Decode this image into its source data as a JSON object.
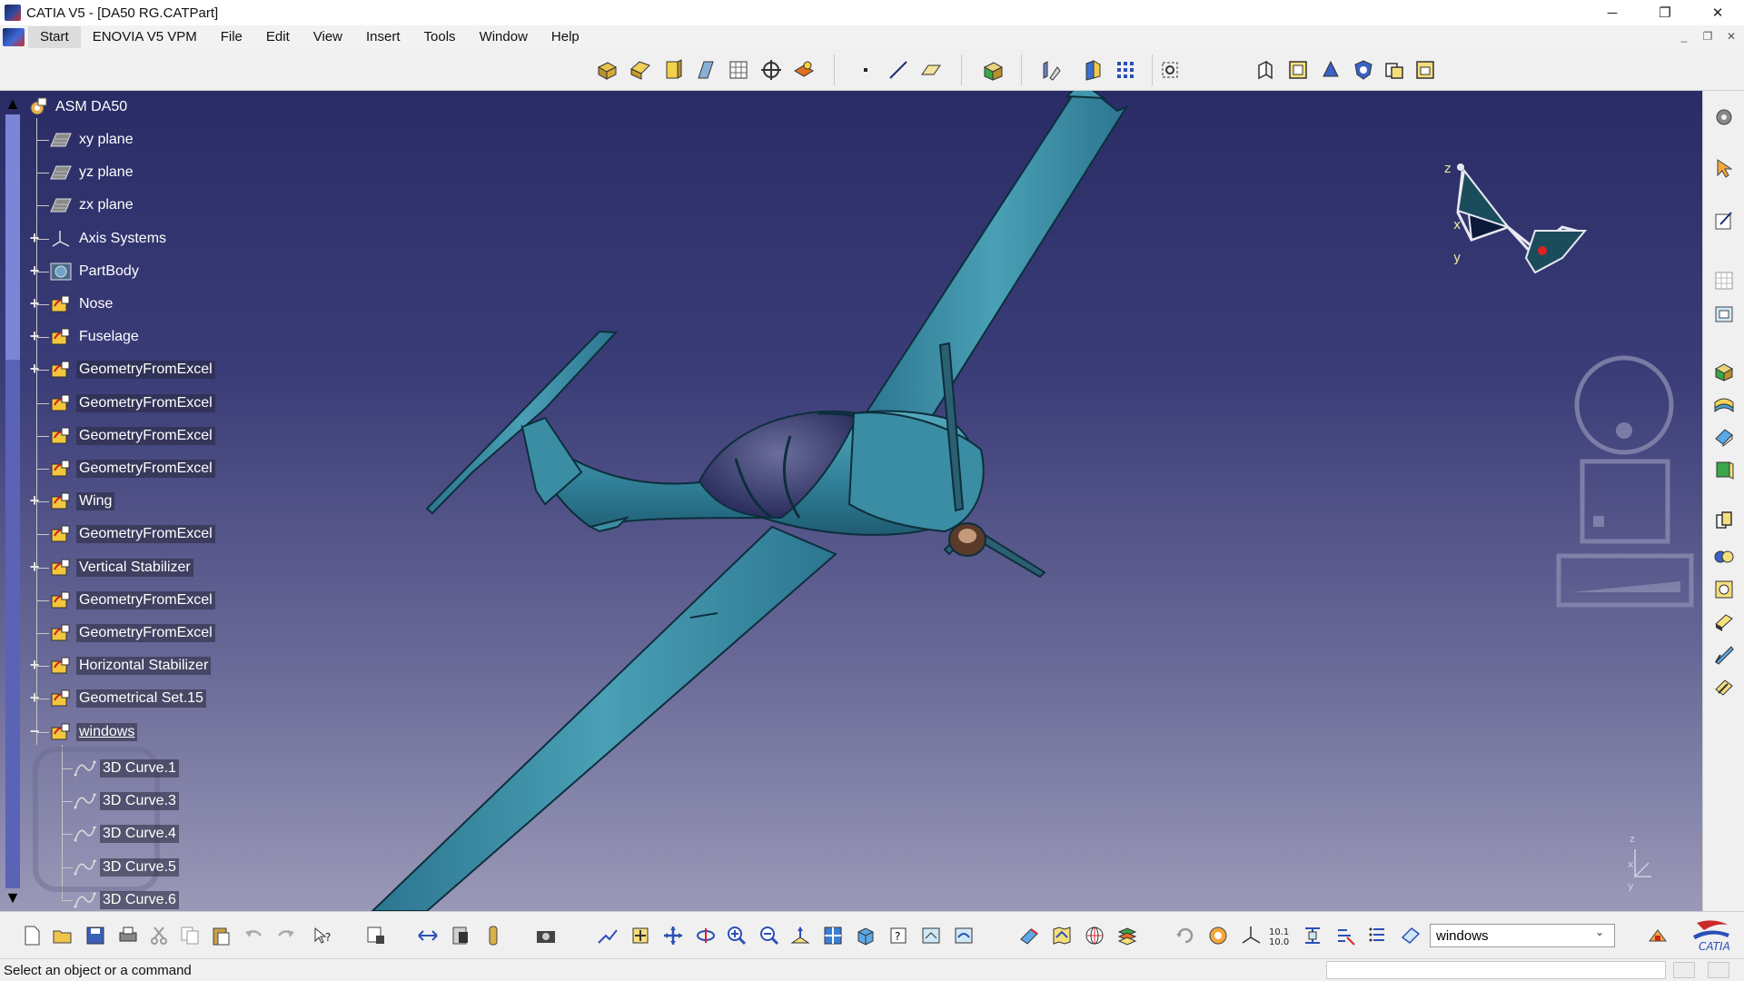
{
  "window": {
    "title": "CATIA V5 - [DA50 RG.CATPart]",
    "minimize": "─",
    "restore": "❐",
    "close": "✕"
  },
  "menu": {
    "items": [
      "Start",
      "ENOVIA V5 VPM",
      "File",
      "Edit",
      "View",
      "Insert",
      "Tools",
      "Window",
      "Help"
    ],
    "mdi_minimize": "_",
    "mdi_restore": "❐",
    "mdi_close": "✕"
  },
  "tree": {
    "root": "ASM DA50",
    "items": [
      {
        "label": "xy plane",
        "icon": "plane-icon",
        "expander": ""
      },
      {
        "label": "yz plane",
        "icon": "plane-icon",
        "expander": ""
      },
      {
        "label": "zx plane",
        "icon": "plane-icon",
        "expander": ""
      },
      {
        "label": "Axis Systems",
        "icon": "axis-system-icon",
        "expander": "+"
      },
      {
        "label": "PartBody",
        "icon": "partbody-icon",
        "expander": "+"
      },
      {
        "label": "Nose",
        "icon": "geometrical-set-icon",
        "expander": "+"
      },
      {
        "label": "Fuselage",
        "icon": "geometrical-set-icon",
        "expander": "+"
      },
      {
        "label": "GeometryFromExcel",
        "icon": "geometrical-set-icon",
        "expander": "+"
      },
      {
        "label": "GeometryFromExcel",
        "icon": "geometrical-set-icon",
        "expander": ""
      },
      {
        "label": "GeometryFromExcel",
        "icon": "geometrical-set-icon",
        "expander": ""
      },
      {
        "label": "GeometryFromExcel",
        "icon": "geometrical-set-icon",
        "expander": ""
      },
      {
        "label": "Wing",
        "icon": "geometrical-set-icon",
        "expander": "+"
      },
      {
        "label": "GeometryFromExcel",
        "icon": "geometrical-set-icon",
        "expander": ""
      },
      {
        "label": "Vertical Stabilizer",
        "icon": "geometrical-set-icon",
        "expander": "+"
      },
      {
        "label": "GeometryFromExcel",
        "icon": "geometrical-set-icon",
        "expander": ""
      },
      {
        "label": "GeometryFromExcel",
        "icon": "geometrical-set-icon",
        "expander": ""
      },
      {
        "label": "Horizontal Stabilizer",
        "icon": "geometrical-set-icon",
        "expander": "+"
      },
      {
        "label": "Geometrical Set.15",
        "icon": "geometrical-set-icon",
        "expander": "+"
      },
      {
        "label": "windows",
        "icon": "geometrical-set-icon",
        "expander": "−"
      }
    ],
    "children": [
      {
        "label": "3D Curve.1"
      },
      {
        "label": "3D Curve.3"
      },
      {
        "label": "3D Curve.4"
      },
      {
        "label": "3D Curve.5"
      },
      {
        "label": "3D Curve.6"
      }
    ]
  },
  "compass": {
    "z": "z",
    "x": "x",
    "y": "y"
  },
  "mini_axis": {
    "z": "z",
    "x": "x",
    "y": "y"
  },
  "power_input": {
    "value": "windows"
  },
  "status": {
    "message": "Select an object or a command"
  },
  "colors": {
    "viewport_top": "#2a2c66",
    "viewport_bottom": "#9a99b8",
    "airplane": "#3a8ea3",
    "tree_scroll": "#5a63b5"
  }
}
